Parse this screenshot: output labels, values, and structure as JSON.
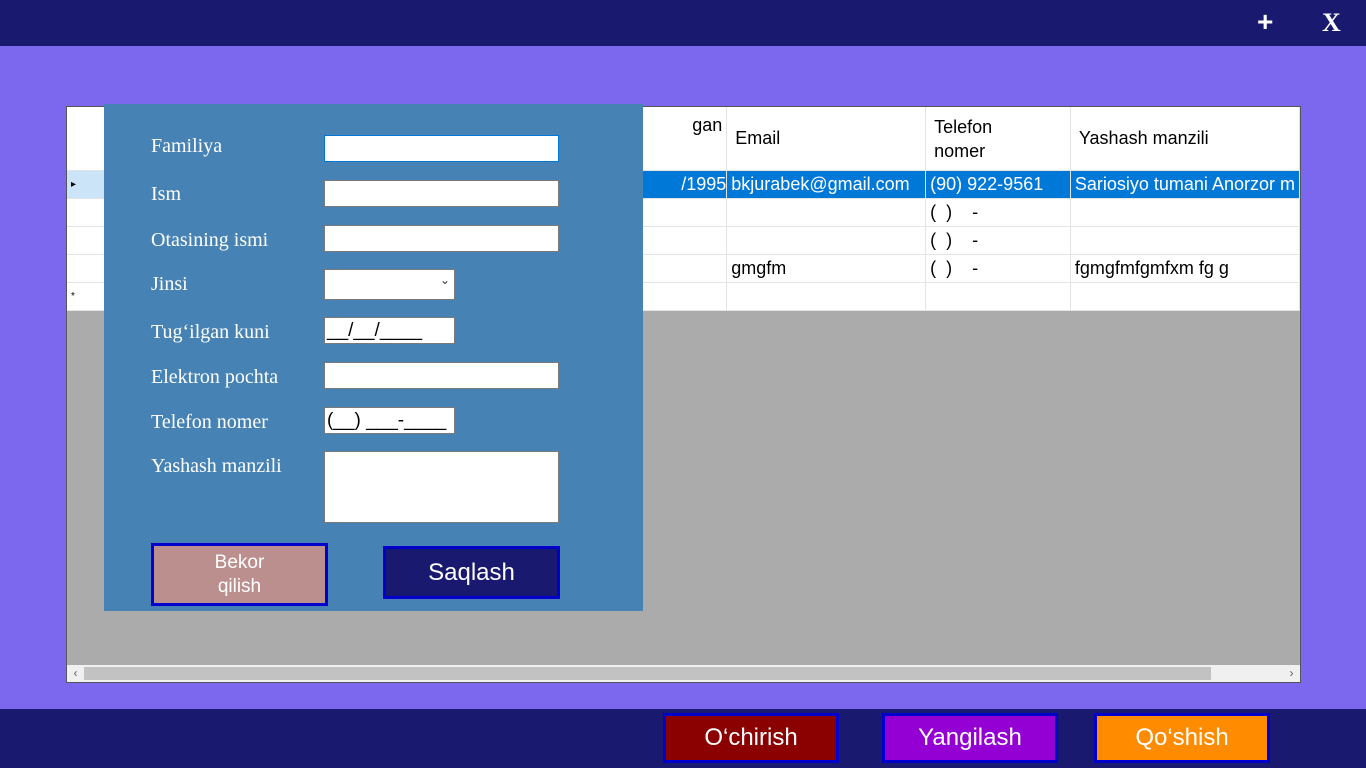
{
  "window": {
    "add_symbol": "+",
    "close_symbol": "X"
  },
  "grid": {
    "columns": [
      "gan",
      "Email",
      "Telefon\nnomer",
      "Yashash manzili"
    ],
    "rows": [
      {
        "marker": "▸",
        "date": "/1995",
        "email": "bkjurabek@gmail.com",
        "phone": "(90) 922-9561",
        "address": "Sariosiyo tumani Anorzor m",
        "selected": true
      },
      {
        "marker": "",
        "date": "",
        "email": "",
        "phone": "(  )    -",
        "address": ""
      },
      {
        "marker": "",
        "date": "",
        "email": "",
        "phone": "(  )    -",
        "address": ""
      },
      {
        "marker": "",
        "date": "",
        "email": "gmgfm",
        "phone": "(  )    -",
        "address": "fgmgfmfgmfxm fg g"
      },
      {
        "marker": "*",
        "date": "",
        "email": "",
        "phone": "",
        "address": ""
      }
    ]
  },
  "form": {
    "labels": {
      "familiya": "Familiya",
      "ism": "Ism",
      "otasining_ismi": "Otasining ismi",
      "jinsi": "Jinsi",
      "tugilgan_kuni": "Tug‘ilgan kuni",
      "elektron_pochta": "Elektron pochta",
      "telefon_nomer": "Telefon nomer",
      "yashash_manzili": "Yashash manzili"
    },
    "values": {
      "familiya": "",
      "ism": "",
      "otasining_ismi": "",
      "jinsi": "",
      "tugilgan_kuni_mask": "__/__/____",
      "elektron_pochta": "",
      "telefon_mask": "(__) ___-____",
      "yashash_manzili": ""
    },
    "buttons": {
      "cancel": "Bekor\nqilish",
      "save": "Saqlash"
    }
  },
  "bottom_buttons": {
    "delete": "O‘chirish",
    "refresh": "Yangilash",
    "add": "Qo‘shish"
  },
  "colors": {
    "background": "#7B68EE",
    "bars": "#191970",
    "dialog": "#4682B4",
    "selection": "#0078D7",
    "delete": "#8B0000",
    "refresh": "#9400D3",
    "add": "#FF8C00",
    "cancel": "#BC8F8F"
  }
}
